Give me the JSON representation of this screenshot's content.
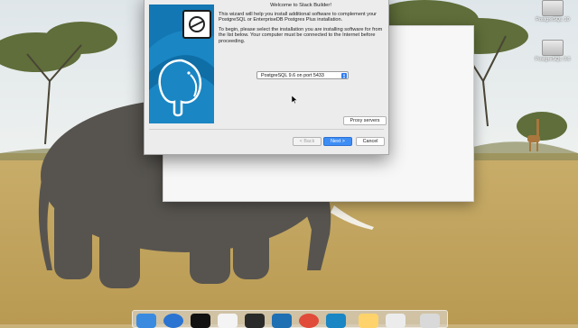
{
  "desktop": {
    "icons": [
      {
        "label": "PostgreSQL 10"
      },
      {
        "label": "PostgreSQL 9.6"
      }
    ]
  },
  "dialog": {
    "title": "Welcome to Stack Builder!",
    "paragraph1": "This wizard will help you install additional software to complement your PostgreSQL or EnterpriseDB Postgres Plus installation.",
    "paragraph2": "To begin, please select the installation you are installing software for from the list below. Your computer must be connected to the Internet before proceeding.",
    "server_select": "PostgreSQL 9.6 on port 5433",
    "proxy_button": "Proxy servers",
    "back_button": "< Back",
    "next_button": "Next >",
    "cancel_button": "Cancel"
  },
  "dock": {
    "items": [
      "finder",
      "safari",
      "terminal",
      "textedit",
      "sublime",
      "vscode",
      "chrome",
      "stackbuilder",
      "preview",
      "notes",
      "trash"
    ]
  },
  "colors": {
    "banner_blue": "#1a86c4",
    "primary_button": "#3d8df5"
  }
}
